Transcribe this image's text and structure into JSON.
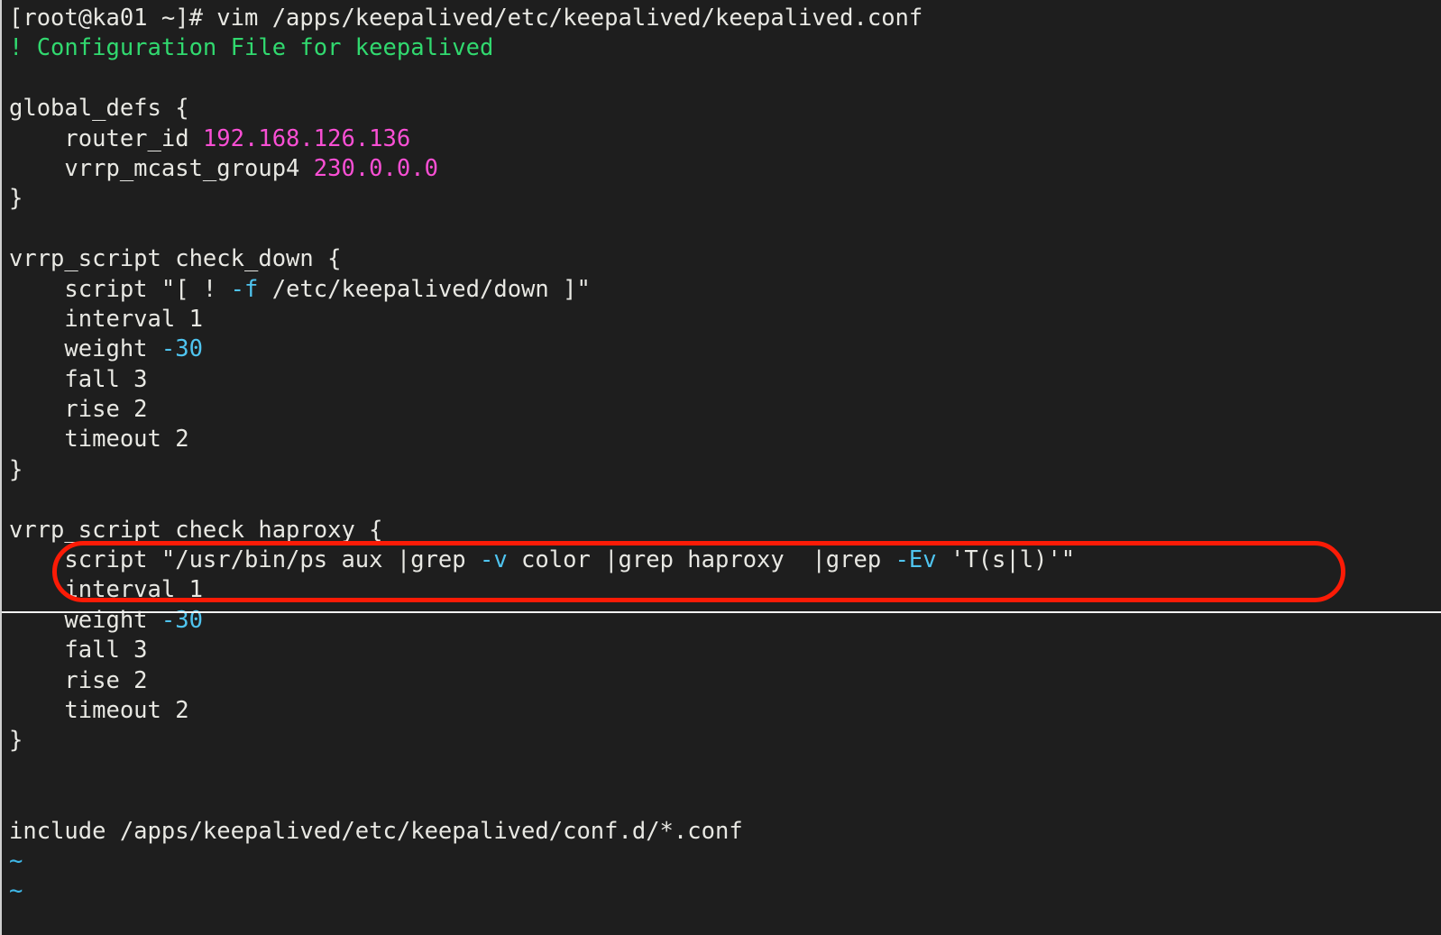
{
  "terminal": {
    "title": "vim /apps/keepalived/etc/keepalived/keepalived.conf",
    "background_color": "#1e1e1e",
    "foreground_color": "#e8e8e3",
    "comment_color": "#31d96f",
    "number_color": "#f94fd4",
    "flag_color": "#4fc4ef",
    "tilde_color": "#3fb8e8",
    "annotation_color": "#fb1b06"
  },
  "prompt": {
    "user_host": "[root@ka01 ~]#",
    "command": "vim /apps/keepalived/etc/keepalived/keepalived.conf",
    "full": "[root@ka01 ~]# vim /apps/keepalived/etc/keepalived/keepalived.conf"
  },
  "editor": {
    "lines": [
      {
        "id": "l01",
        "type": "prompt",
        "text": "[root@ka01 ~]# vim /apps/keepalived/etc/keepalived/keepalived.conf"
      },
      {
        "id": "l02",
        "type": "comment",
        "text": "! Configuration File for keepalived"
      },
      {
        "id": "l03",
        "type": "blank",
        "text": ""
      },
      {
        "id": "l04",
        "type": "code",
        "text": "global_defs {"
      },
      {
        "id": "l05",
        "type": "code",
        "text": "    router_id 192.168.126.136",
        "key": "    router_id ",
        "value": "192.168.126.136"
      },
      {
        "id": "l06",
        "type": "code",
        "text": "    vrrp_mcast_group4 230.0.0.0",
        "key": "    vrrp_mcast_group4 ",
        "value": "230.0.0.0"
      },
      {
        "id": "l07",
        "type": "code",
        "text": "}"
      },
      {
        "id": "l08",
        "type": "blank",
        "text": ""
      },
      {
        "id": "l09",
        "type": "code",
        "text": "vrrp_script check_down {"
      },
      {
        "id": "l10",
        "type": "code",
        "text": "    script \"[ ! -f /etc/keepalived/down ]\""
      },
      {
        "id": "l11",
        "type": "code",
        "text": "    interval 1"
      },
      {
        "id": "l12",
        "type": "code",
        "text": "    weight -30"
      },
      {
        "id": "l13",
        "type": "code",
        "text": "    fall 3"
      },
      {
        "id": "l14",
        "type": "code",
        "text": "    rise 2"
      },
      {
        "id": "l15",
        "type": "code",
        "text": "    timeout 2"
      },
      {
        "id": "l16",
        "type": "code",
        "text": "}"
      },
      {
        "id": "l17",
        "type": "blank",
        "text": ""
      },
      {
        "id": "l18",
        "type": "code",
        "text": "vrrp_script check_haproxy {"
      },
      {
        "id": "l19",
        "type": "code",
        "text": "    script \"/usr/bin/ps aux |grep -v color |grep haproxy  |grep -Ev 'T(s|l)'\"",
        "highlighted": true
      },
      {
        "id": "l20",
        "type": "code",
        "text": "    interval 1"
      },
      {
        "id": "l21",
        "type": "code",
        "text": "    weight -30"
      },
      {
        "id": "l22",
        "type": "code",
        "text": "    fall 3"
      },
      {
        "id": "l23",
        "type": "code",
        "text": "    rise 2"
      },
      {
        "id": "l24",
        "type": "code",
        "text": "    timeout 2"
      },
      {
        "id": "l25",
        "type": "code",
        "text": "}"
      },
      {
        "id": "l26",
        "type": "blank",
        "text": ""
      },
      {
        "id": "l27",
        "type": "blank",
        "text": ""
      },
      {
        "id": "l28",
        "type": "code",
        "text": "include /apps/keepalived/etc/keepalived/conf.d/*.conf"
      },
      {
        "id": "l29",
        "type": "tilde",
        "text": "~"
      },
      {
        "id": "l30",
        "type": "tilde",
        "text": "~"
      }
    ],
    "segments": {
      "line01": [
        {
          "t": "[root@ka01 ~]# vim /apps/keepalived/etc/keepalived/keepalived.conf",
          "c": "c-default"
        }
      ],
      "line02": [
        {
          "t": "! Configuration File for keepalived",
          "c": "c-comment"
        }
      ],
      "line04": [
        {
          "t": "global_defs {",
          "c": "c-default"
        }
      ],
      "line05": [
        {
          "t": "    router_id ",
          "c": "c-default"
        },
        {
          "t": "192.168.126.136",
          "c": "c-number"
        }
      ],
      "line06": [
        {
          "t": "    vrrp_mcast_group4 ",
          "c": "c-default"
        },
        {
          "t": "230.0.0.0",
          "c": "c-number"
        }
      ],
      "line07": [
        {
          "t": "}",
          "c": "c-default"
        }
      ],
      "line09": [
        {
          "t": "vrrp_script check_down {",
          "c": "c-default"
        }
      ],
      "line10": [
        {
          "t": "    script \"[ ! ",
          "c": "c-default"
        },
        {
          "t": "-f",
          "c": "c-flag"
        },
        {
          "t": " /etc/keepalived/down ]\"",
          "c": "c-default"
        }
      ],
      "line11": [
        {
          "t": "    interval 1",
          "c": "c-default"
        }
      ],
      "line12": [
        {
          "t": "    weight ",
          "c": "c-default"
        },
        {
          "t": "-30",
          "c": "c-flag"
        }
      ],
      "line13": [
        {
          "t": "    fall 3",
          "c": "c-default"
        }
      ],
      "line14": [
        {
          "t": "    rise 2",
          "c": "c-default"
        }
      ],
      "line15": [
        {
          "t": "    timeout 2",
          "c": "c-default"
        }
      ],
      "line16": [
        {
          "t": "}",
          "c": "c-default"
        }
      ],
      "line18": [
        {
          "t": "vrrp_script check_haproxy {",
          "c": "c-default"
        }
      ],
      "line19": [
        {
          "t": "    script \"/usr/bin/ps aux |grep ",
          "c": "c-default"
        },
        {
          "t": "-v",
          "c": "c-flag"
        },
        {
          "t": " color |grep haproxy  |grep ",
          "c": "c-default"
        },
        {
          "t": "-Ev",
          "c": "c-flag"
        },
        {
          "t": " 'T(s|l)'\"",
          "c": "c-default"
        }
      ],
      "line20": [
        {
          "t": "    interval 1",
          "c": "c-default"
        }
      ],
      "line21": [
        {
          "t": "    weight ",
          "c": "c-default"
        },
        {
          "t": "-30",
          "c": "c-flag"
        }
      ],
      "line22": [
        {
          "t": "    fall 3",
          "c": "c-default"
        }
      ],
      "line23": [
        {
          "t": "    rise 2",
          "c": "c-default"
        }
      ],
      "line24": [
        {
          "t": "    timeout 2",
          "c": "c-default"
        }
      ],
      "line25": [
        {
          "t": "}",
          "c": "c-default"
        }
      ],
      "line28": [
        {
          "t": "include /apps/keepalived/etc/keepalived/conf.d/*.conf",
          "c": "c-default"
        }
      ],
      "line29": [
        {
          "t": "~",
          "c": "c-tilde"
        }
      ],
      "line30": [
        {
          "t": "~",
          "c": "c-tilde"
        }
      ]
    }
  },
  "annotations": {
    "ellipse_label": "highlighted script line: check_haproxy script",
    "rule_label": "horizontal separator rule"
  }
}
